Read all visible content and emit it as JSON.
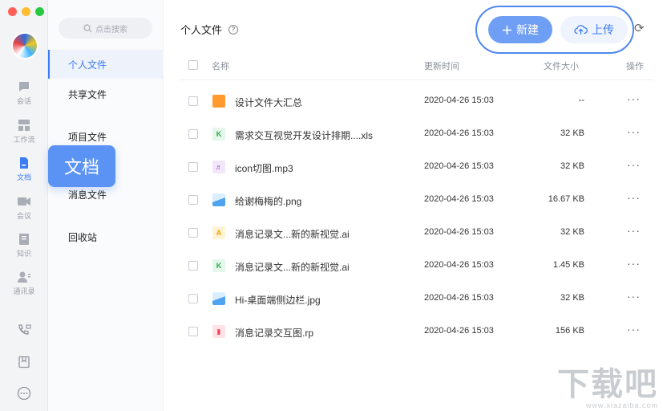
{
  "window": {
    "traffic_colors": [
      "#ff5f57",
      "#febc2e",
      "#28c840"
    ]
  },
  "rail": {
    "items": [
      {
        "label": "会话",
        "icon": "chat-icon"
      },
      {
        "label": "工作流",
        "icon": "workflow-icon"
      },
      {
        "label": "文档",
        "icon": "document-icon"
      },
      {
        "label": "会议",
        "icon": "meeting-icon"
      },
      {
        "label": "知识",
        "icon": "knowledge-icon"
      },
      {
        "label": "通讯录",
        "icon": "contacts-icon"
      }
    ],
    "bottom_icons": [
      "phone-icon",
      "bookmark-icon",
      "more-circle-icon"
    ]
  },
  "sidebar": {
    "search_placeholder": "点击搜索",
    "items": [
      {
        "label": "个人文件"
      },
      {
        "label": "共享文件"
      },
      {
        "label": "项目文件"
      },
      {
        "label": "消息文件"
      },
      {
        "label": "回收站"
      }
    ]
  },
  "tooltip": {
    "label": "文档"
  },
  "header": {
    "title": "个人文件",
    "help": "?",
    "new_button": "新建",
    "upload_button": "上传"
  },
  "table": {
    "columns": {
      "name": "名称",
      "updated": "更新时间",
      "size": "文件大小",
      "actions": "操作"
    },
    "rows": [
      {
        "name": "设计文件大汇总",
        "updated": "2020-04-26 15:03",
        "size": "--",
        "type": "folder-icon",
        "more": "···"
      },
      {
        "name": "需求交互视觉开发设计排期....xls",
        "updated": "2020-04-26 15:03",
        "size": "32 KB",
        "type": "excel-icon",
        "more": "···"
      },
      {
        "name": "icon切图.mp3",
        "updated": "2020-04-26 15:03",
        "size": "32 KB",
        "type": "audio-icon",
        "more": "···"
      },
      {
        "name": "给谢梅梅的.png",
        "updated": "2020-04-26 15:03",
        "size": "16.67 KB",
        "type": "image-icon",
        "more": "···"
      },
      {
        "name": "消息记录文...新的新视觉.ai",
        "updated": "2020-04-26 15:03",
        "size": "32 KB",
        "type": "ai-icon",
        "more": "···"
      },
      {
        "name": "消息记录文...新的新视觉.ai",
        "updated": "2020-04-26 15:03",
        "size": "1.45 KB",
        "type": "excel-icon",
        "more": "···"
      },
      {
        "name": "Hi-桌面端侧边栏.jpg",
        "updated": "2020-04-26 15:03",
        "size": "32 KB",
        "type": "image-icon",
        "more": "···"
      },
      {
        "name": "消息记录交互图.rp",
        "updated": "2020-04-26 15:03",
        "size": "156 KB",
        "type": "rp-icon",
        "more": "···"
      }
    ]
  },
  "watermark": {
    "big": "下载吧",
    "small": "www.xiazaiba.com"
  }
}
